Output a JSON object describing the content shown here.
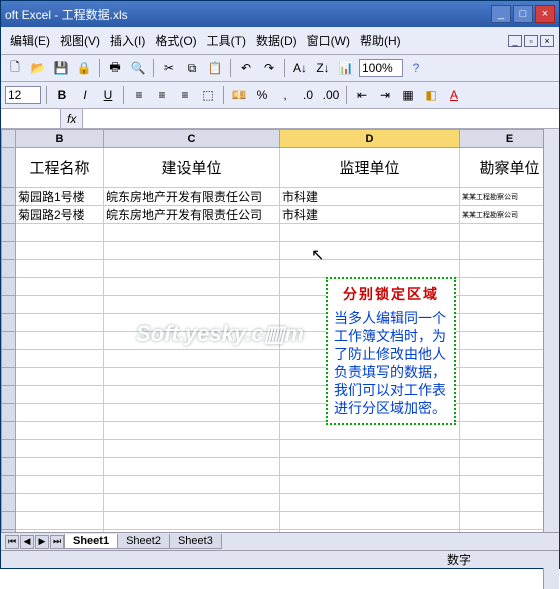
{
  "window": {
    "title": "oft Excel - 工程数据.xls"
  },
  "menu": {
    "edit": "编辑(E)",
    "view": "视图(V)",
    "insert": "插入(I)",
    "format": "格式(O)",
    "tools": "工具(T)",
    "data": "数据(D)",
    "window": "窗口(W)",
    "help": "帮助(H)"
  },
  "toolbar": {
    "font_size": "12",
    "zoom": "100%"
  },
  "columns": [
    "",
    "B",
    "C",
    "D",
    "E"
  ],
  "headers": {
    "B": "工程名称",
    "C": "建设单位",
    "D": "监理单位",
    "E": "勘察单位"
  },
  "rows": [
    {
      "B": "菊园路1号楼",
      "C": "皖东房地产开发有限责任公司",
      "D": "市科建",
      "E": "司"
    },
    {
      "B": "菊园路2号楼",
      "C": "皖东房地产开发有限责任公司",
      "D": "市科建",
      "E": "司"
    }
  ],
  "callout": {
    "title": "分别锁定区域",
    "body": "当多人编辑同一个工作簿文档时，为了防止修改由他人负责填写的数据，我们可以对工作表进行分区域加密。"
  },
  "watermark": "Soft.yesky.c▥m",
  "tabs": [
    "Sheet1",
    "Sheet2",
    "Sheet3"
  ],
  "status": "数字",
  "etext": "某某工程勘察公司"
}
